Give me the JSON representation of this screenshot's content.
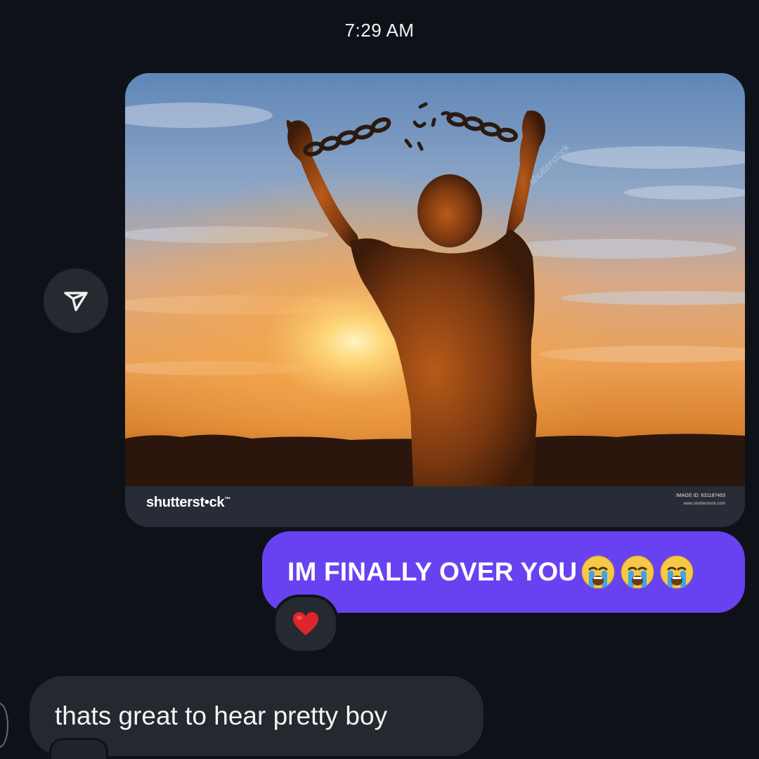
{
  "header": {
    "timestamp": "7:29 AM"
  },
  "share_button": {
    "icon": "send-icon"
  },
  "image_message": {
    "watermark_brand": "shutterst•ck",
    "trademark": "™",
    "image_id_text": "IMAGE ID: 631187453",
    "watermark_url": "www.shutterstock.com"
  },
  "sent_message": {
    "text": "IM FINALLY OVER YOU",
    "emoji": [
      "crying-face",
      "crying-face",
      "crying-face"
    ],
    "bubble_color": "#6842f0"
  },
  "reaction": {
    "emoji": "red-heart"
  },
  "received_message": {
    "text": "thats great to hear pretty boy"
  },
  "colors": {
    "background": "#0e1218",
    "received_bubble": "#24292f",
    "sent_bubble": "#6842f0"
  }
}
